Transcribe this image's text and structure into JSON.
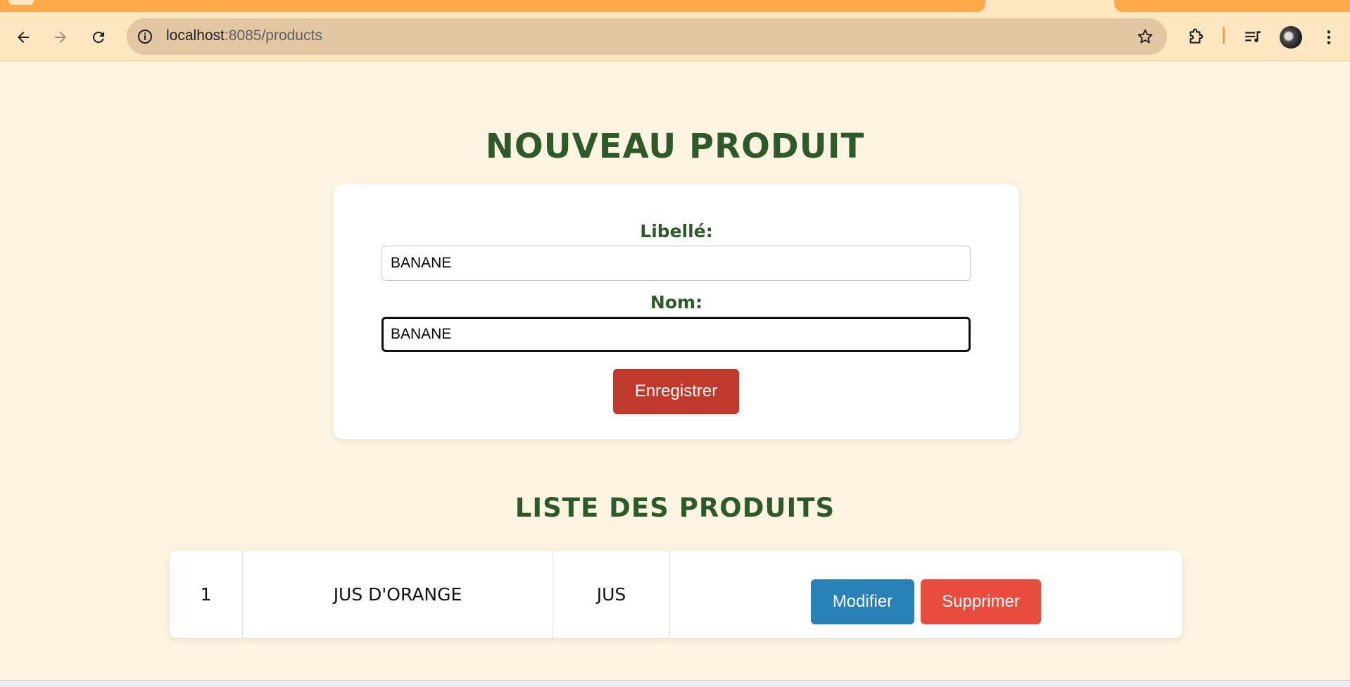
{
  "browser": {
    "url_host": "localhost",
    "url_path": ":8085/products",
    "icons": {
      "back": "back-arrow-icon",
      "forward": "forward-arrow-icon",
      "reload": "reload-icon",
      "site_info": "info-icon",
      "bookmark": "star-icon",
      "extensions": "puzzle-icon",
      "media": "media-playlist-icon",
      "menu": "more-vert-icon"
    },
    "accent_color": "#ffa84a"
  },
  "form": {
    "title": "NOUVEAU PRODUIT",
    "libelle_label": "Libellé:",
    "libelle_value": "BANANE",
    "nom_label": "Nom:",
    "nom_value": "BANANE",
    "save_label": "Enregistrer"
  },
  "list": {
    "title": "LISTE DES PRODUITS",
    "rows": [
      {
        "id": "1",
        "libelle": "JUS D'ORANGE",
        "nom": "JUS",
        "edit_label": "Modifier",
        "delete_label": "Supprimer"
      }
    ]
  },
  "colors": {
    "background": "#fdf5e1",
    "heading": "#2e5a2a",
    "save_button": "#c0392b",
    "edit_button": "#2980b9",
    "delete_button": "#e74c3c"
  }
}
